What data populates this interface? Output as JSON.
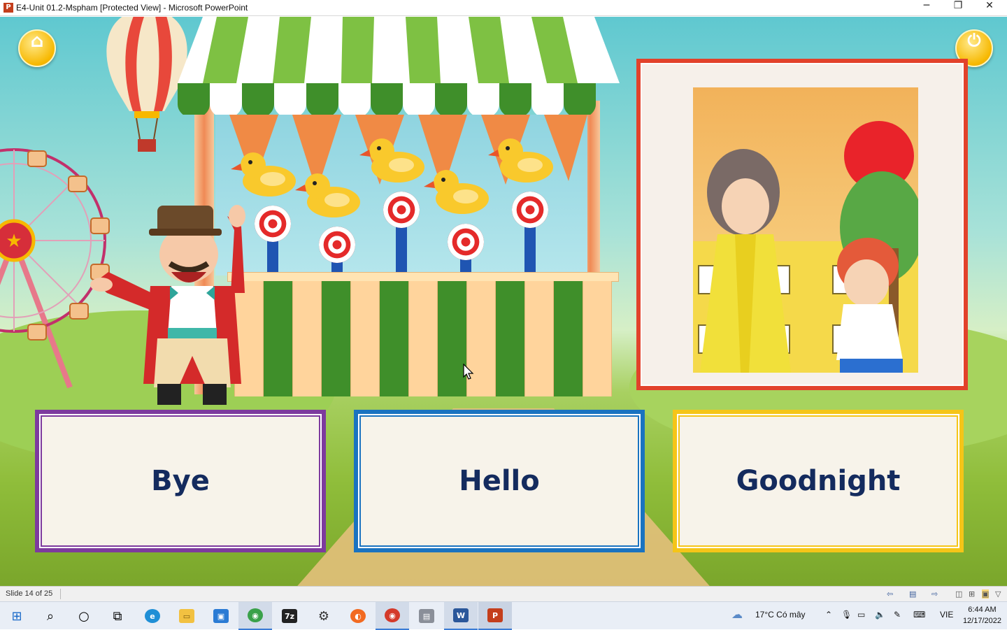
{
  "window": {
    "title": "E4-Unit 01.2-Mspham [Protected View] - Microsoft PowerPoint",
    "app_icon": "P",
    "controls": {
      "minimize": "─",
      "restore": "❐",
      "close": "✕"
    }
  },
  "slide": {
    "home_icon": "⌂",
    "power_icon": "⏻",
    "answers": [
      {
        "label": "Bye",
        "color": "#7d3a9e"
      },
      {
        "label": "Hello",
        "color": "#1a73c0"
      },
      {
        "label": "Goodnight",
        "color": "#f5c518"
      }
    ],
    "frame_color": "#e2422b"
  },
  "statusbar": {
    "slide_info": "Slide 14 of 25"
  },
  "taskbar": {
    "apps": [
      {
        "name": "start-button",
        "glyph": "⊞"
      },
      {
        "name": "search-button",
        "glyph": "⌕"
      },
      {
        "name": "cortana-button",
        "glyph": "○"
      },
      {
        "name": "task-view-button",
        "glyph": "⧉"
      },
      {
        "name": "edge-app",
        "glyph": "e"
      },
      {
        "name": "file-explorer-app",
        "glyph": "▭"
      },
      {
        "name": "store-app",
        "glyph": "▣"
      },
      {
        "name": "chrome-app",
        "glyph": "◉"
      },
      {
        "name": "7zip-app",
        "glyph": "7z"
      },
      {
        "name": "settings-app",
        "glyph": "⚙"
      },
      {
        "name": "firefox-app",
        "glyph": "◐"
      },
      {
        "name": "chrome-profile-app",
        "glyph": "◉"
      },
      {
        "name": "package-app",
        "glyph": "▤"
      },
      {
        "name": "word-app",
        "glyph": "W"
      },
      {
        "name": "powerpoint-app",
        "glyph": "P"
      }
    ],
    "weather": "17°C  Có mây",
    "language": "VIE",
    "time": "6:44 AM",
    "date": "12/17/2022"
  }
}
